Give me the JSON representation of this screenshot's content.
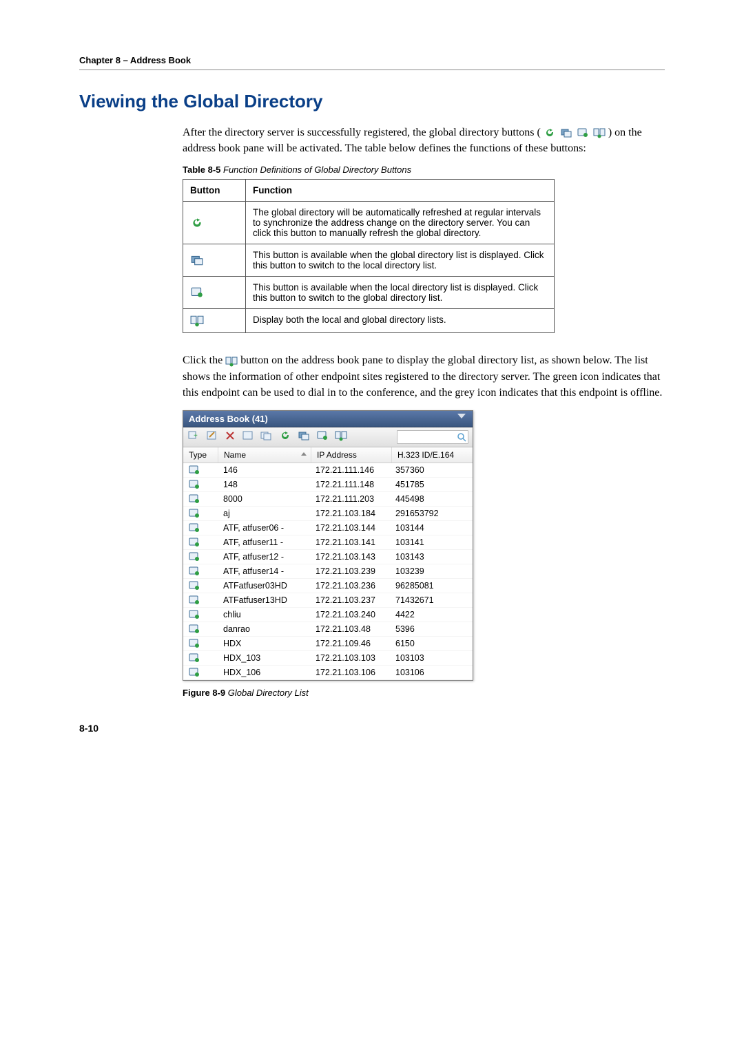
{
  "chapter_line": "Chapter 8 – Address Book",
  "heading": "Viewing the Global Directory",
  "para1a": "After the directory server is successfully registered, the global directory buttons (",
  "para1b": ") on the address book pane will be activated. The table below defines the functions of these buttons:",
  "table_caption_bold": "Table 8-5",
  "table_caption_rest": " Function Definitions of Global Directory Buttons",
  "th_button": "Button",
  "th_function": "Function",
  "defs": [
    "The global directory will be automatically refreshed at regular intervals to synchronize the address change on the directory server. You can click this button to manually refresh the global directory.",
    "This button is available when the global directory list is displayed. Click this button to switch to the local directory list.",
    "This button is available when the local directory list is displayed. Click this button to switch to the global directory list.",
    "Display both the local and global directory lists."
  ],
  "para2a": "Click the ",
  "para2b": " button on the address book pane to display the global directory list, as shown below. The list shows the information of other endpoint sites registered to the directory server. The green icon indicates that this endpoint can be used to dial in to the conference, and the grey icon indicates that this endpoint is offline.",
  "ab_title": "Address Book (41)",
  "ab_cols": {
    "type": "Type",
    "name": "Name",
    "ip": "IP Address",
    "h323": "H.323 ID/E.164"
  },
  "ab_rows": [
    {
      "name": "146",
      "ip": "172.21.111.146",
      "h323": "357360"
    },
    {
      "name": "148",
      "ip": "172.21.111.148",
      "h323": "451785"
    },
    {
      "name": "8000",
      "ip": "172.21.111.203",
      "h323": "445498"
    },
    {
      "name": "aj",
      "ip": "172.21.103.184",
      "h323": "291653792"
    },
    {
      "name": "ATF, atfuser06 -",
      "ip": "172.21.103.144",
      "h323": "103144"
    },
    {
      "name": "ATF, atfuser11 -",
      "ip": "172.21.103.141",
      "h323": "103141"
    },
    {
      "name": "ATF, atfuser12 -",
      "ip": "172.21.103.143",
      "h323": "103143"
    },
    {
      "name": "ATF, atfuser14 -",
      "ip": "172.21.103.239",
      "h323": "103239"
    },
    {
      "name": "ATFatfuser03HD",
      "ip": "172.21.103.236",
      "h323": "96285081"
    },
    {
      "name": "ATFatfuser13HD",
      "ip": "172.21.103.237",
      "h323": "71432671"
    },
    {
      "name": "chliu",
      "ip": "172.21.103.240",
      "h323": "4422"
    },
    {
      "name": "danrao",
      "ip": "172.21.103.48",
      "h323": "5396"
    },
    {
      "name": "HDX",
      "ip": "172.21.109.46",
      "h323": "6150"
    },
    {
      "name": "HDX_103",
      "ip": "172.21.103.103",
      "h323": "103103"
    },
    {
      "name": "HDX_106",
      "ip": "172.21.103.106",
      "h323": "103106"
    }
  ],
  "figure_caption_bold": "Figure 8-9",
  "figure_caption_rest": " Global Directory List",
  "page_number": "8-10"
}
